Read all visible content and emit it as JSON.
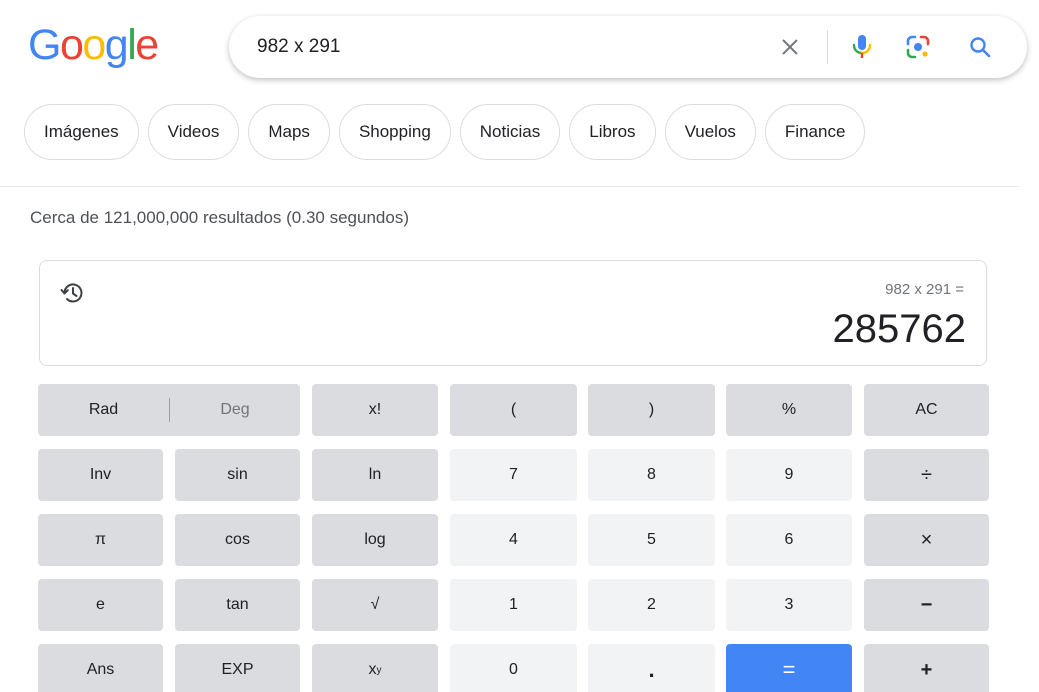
{
  "logo": {
    "letters": [
      "G",
      "o",
      "o",
      "g",
      "l",
      "e"
    ],
    "colors": [
      "#4285f4",
      "#ea4335",
      "#fbbc05",
      "#4285f4",
      "#34a853",
      "#ea4335"
    ]
  },
  "search": {
    "query": "982 x 291",
    "icons": [
      "close-icon",
      "microphone-icon",
      "camera-lens-icon",
      "search-icon"
    ]
  },
  "tabs": [
    "Imágenes",
    "Videos",
    "Maps",
    "Shopping",
    "Noticias",
    "Libros",
    "Vuelos",
    "Finance"
  ],
  "result_stats": "Cerca de 121,000,000 resultados (0.30 segundos)",
  "calculator": {
    "expression": "982 x 291 =",
    "result": "285762",
    "history_icon": "history-icon",
    "rad_label": "Rad",
    "deg_label": "Deg",
    "keys": {
      "factorial": "x!",
      "open_paren": "(",
      "close_paren": ")",
      "percent": "%",
      "clear": "AC",
      "inv": "Inv",
      "sin": "sin",
      "ln": "ln",
      "seven": "7",
      "eight": "8",
      "nine": "9",
      "divide": "÷",
      "pi": "π",
      "cos": "cos",
      "log": "log",
      "four": "4",
      "five": "5",
      "six": "6",
      "multiply": "×",
      "e": "e",
      "tan": "tan",
      "sqrt": "√",
      "one": "1",
      "two": "2",
      "three": "3",
      "minus": "−",
      "ans": "Ans",
      "exp": "EXP",
      "power_base": "x",
      "power_exp": "y",
      "zero": "0",
      "dot": ".",
      "equals": "=",
      "plus": "+"
    }
  },
  "colors": {
    "accent_blue": "#4285f4",
    "fn_key": "#dadce0",
    "num_key": "#f1f3f4",
    "text": "#202124",
    "muted": "#70757a"
  }
}
